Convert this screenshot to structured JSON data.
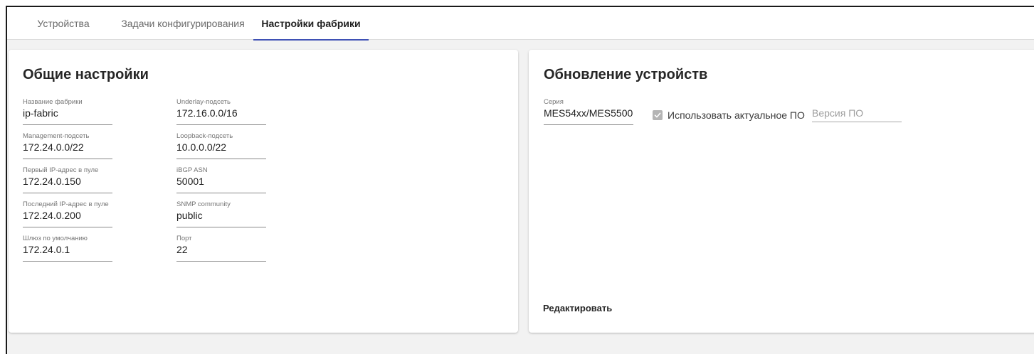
{
  "tabs": [
    {
      "label": "Устройства",
      "active": false
    },
    {
      "label": "Задачи конфигурирования",
      "active": false
    },
    {
      "label": "Настройки фабрики",
      "active": true
    }
  ],
  "general_settings": {
    "title": "Общие настройки",
    "fields": [
      {
        "label": "Название фабрики",
        "value": "ip-fabric"
      },
      {
        "label": "Underlay-подсеть",
        "value": "172.16.0.0/16"
      },
      {
        "label": "Management-подсеть",
        "value": "172.24.0.0/22"
      },
      {
        "label": "Loopback-подсеть",
        "value": "10.0.0.0/22"
      },
      {
        "label": "Первый IP-адрес в пуле",
        "value": "172.24.0.150"
      },
      {
        "label": "iBGP ASN",
        "value": "50001"
      },
      {
        "label": "Последний IP-адрес в пуле",
        "value": "172.24.0.200"
      },
      {
        "label": "SNMP community",
        "value": "public"
      },
      {
        "label": "Шлюз по умолчанию",
        "value": "172.24.0.1"
      },
      {
        "label": "Порт",
        "value": "22"
      }
    ]
  },
  "device_update": {
    "title": "Обновление устройств",
    "series": {
      "label": "Серия",
      "value": "MES54xx/MES5500"
    },
    "use_latest_fw": {
      "label": "Использовать актуальное ПО",
      "checked": true,
      "icon": "check-icon"
    },
    "fw_version": {
      "placeholder": "Версия ПО",
      "value": ""
    },
    "edit_button": "Редактировать"
  },
  "colors": {
    "accent": "#3f51b5",
    "background": "#f2f2f2",
    "card": "#ffffff",
    "checkbox": "#b4b4b4"
  }
}
